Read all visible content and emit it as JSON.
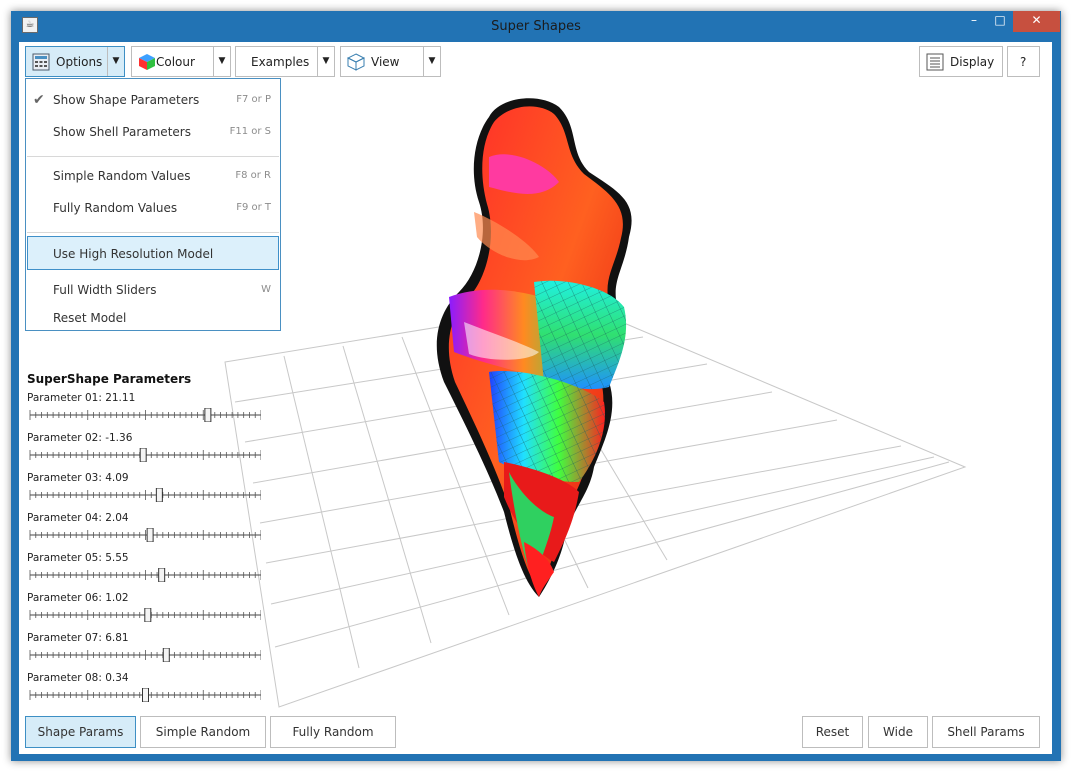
{
  "window": {
    "title": "Super Shapes",
    "minimize": "–",
    "maximize": "□",
    "close": "✕",
    "app_icon": "☕"
  },
  "toolbar": {
    "options_label": "Options",
    "colour_label": "Colour",
    "examples_label": "Examples",
    "view_label": "View",
    "display_label": "Display",
    "help_label": "?",
    "dropdown_arrow": "▼"
  },
  "options_menu": {
    "items": [
      {
        "label": "Show Shape Parameters",
        "accel": "F7 or P",
        "checked": "✔"
      },
      {
        "label": "Show Shell Parameters",
        "accel": "F11 or S"
      },
      {
        "label": "Simple Random Values",
        "accel": "F8 or R"
      },
      {
        "label": "Fully Random Values",
        "accel": "F9 or T"
      },
      {
        "label": "Use High Resolution Model",
        "accel": ""
      },
      {
        "label": "Full Width Sliders",
        "accel": "W"
      },
      {
        "label": "Reset Model",
        "accel": ""
      }
    ]
  },
  "params": {
    "title": "SuperShape Parameters",
    "items": [
      {
        "label": "Parameter 01: 21.11",
        "fraction": 0.77
      },
      {
        "label": "Parameter 02: -1.36",
        "fraction": 0.49
      },
      {
        "label": "Parameter 03: 4.09",
        "fraction": 0.56
      },
      {
        "label": "Parameter 04: 2.04",
        "fraction": 0.52
      },
      {
        "label": "Parameter 05: 5.55",
        "fraction": 0.57
      },
      {
        "label": "Parameter 06: 1.02",
        "fraction": 0.51
      },
      {
        "label": "Parameter 07: 6.81",
        "fraction": 0.59
      },
      {
        "label": "Parameter 08: 0.34",
        "fraction": 0.5
      }
    ]
  },
  "bottom": {
    "shape_params": "Shape Params",
    "simple_random": "Simple Random",
    "fully_random": "Fully Random",
    "reset": "Reset",
    "wide": "Wide",
    "shell_params": "Shell Params"
  },
  "colors": {
    "window_border": "#2273b4",
    "accent": "#3d8fc4",
    "highlight": "#d6ecf8"
  }
}
